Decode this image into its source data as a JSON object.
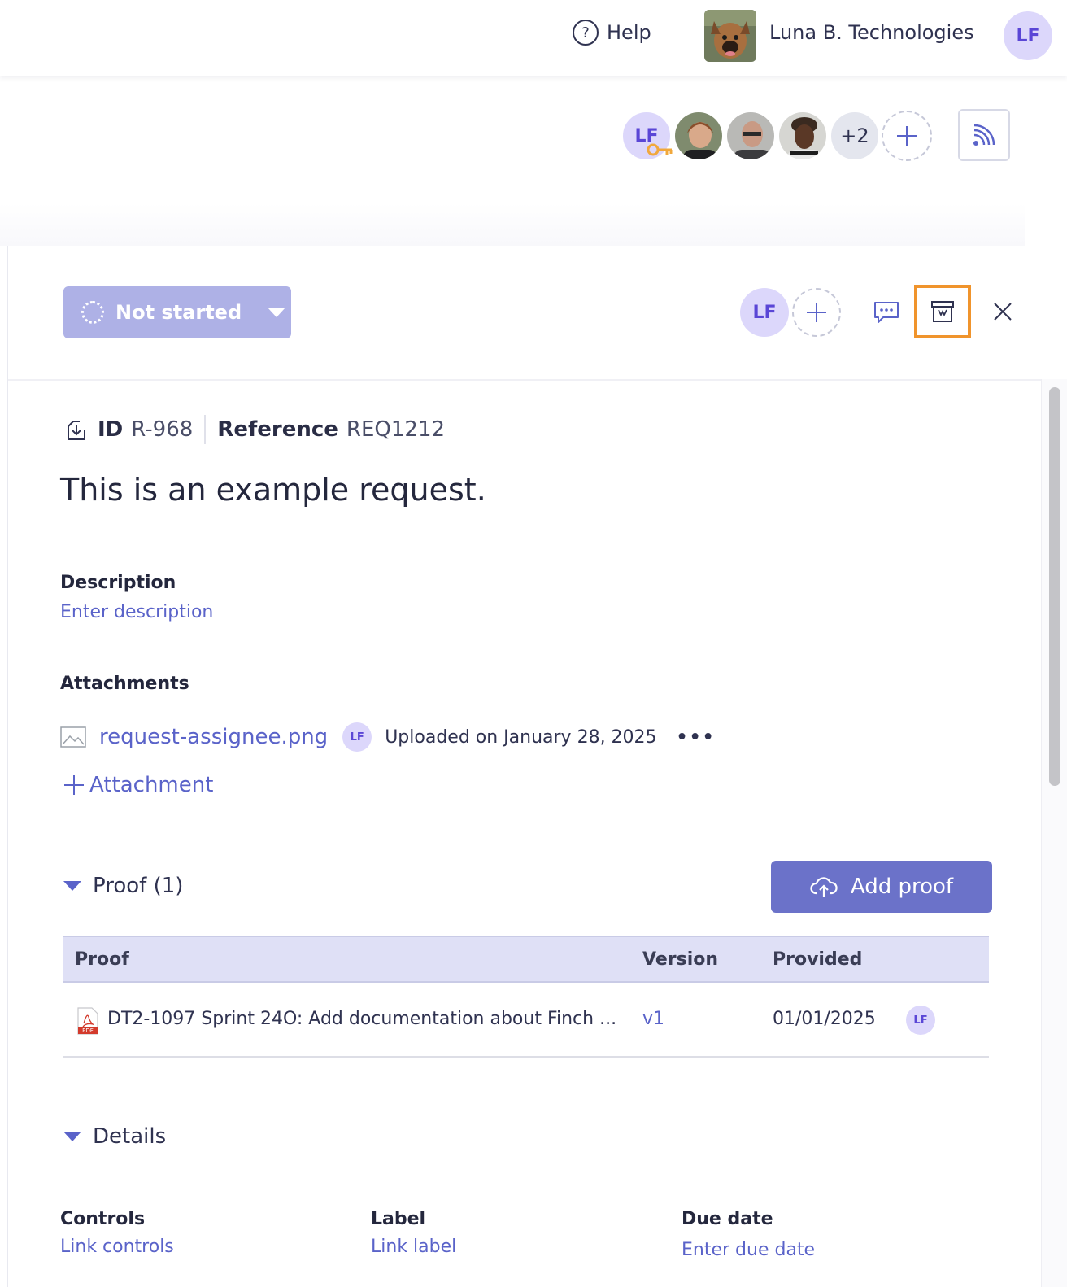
{
  "header": {
    "help_label": "Help",
    "org_name": "Luna B. Technologies",
    "user_initials": "LF"
  },
  "members": {
    "owner_initials": "LF",
    "more_count": "+2"
  },
  "toolbar": {
    "status_label": "Not started",
    "assignee_initials": "LF"
  },
  "request": {
    "id_label": "ID",
    "id_value": "R-968",
    "reference_label": "Reference",
    "reference_value": "REQ1212",
    "title": "This is an example request."
  },
  "description": {
    "label": "Description",
    "placeholder": "Enter description"
  },
  "attachments": {
    "label": "Attachments",
    "items": [
      {
        "name": "request-assignee.png",
        "uploader_initials": "LF",
        "uploaded": "Uploaded on January 28, 2025",
        "more": "•••"
      }
    ],
    "add_label": "Attachment"
  },
  "proof": {
    "section_label": "Proof (1)",
    "add_button_label": "Add proof",
    "columns": [
      "Proof",
      "Version",
      "Provided"
    ],
    "rows": [
      {
        "name": "DT2-1097 Sprint 24O: Add documentation about Finch ...",
        "version": "v1",
        "provided": "01/01/2025",
        "provider_initials": "LF"
      }
    ]
  },
  "details": {
    "section_label": "Details",
    "fields": [
      {
        "label": "Controls",
        "link": "Link controls"
      },
      {
        "label": "Label",
        "link": "Link label"
      },
      {
        "label": "Due date",
        "link": "Enter due date"
      }
    ]
  },
  "colors": {
    "accent": "#5a63c9",
    "button": "#6b72c9",
    "status": "#aeb1e6",
    "highlight": "#f0942c"
  }
}
